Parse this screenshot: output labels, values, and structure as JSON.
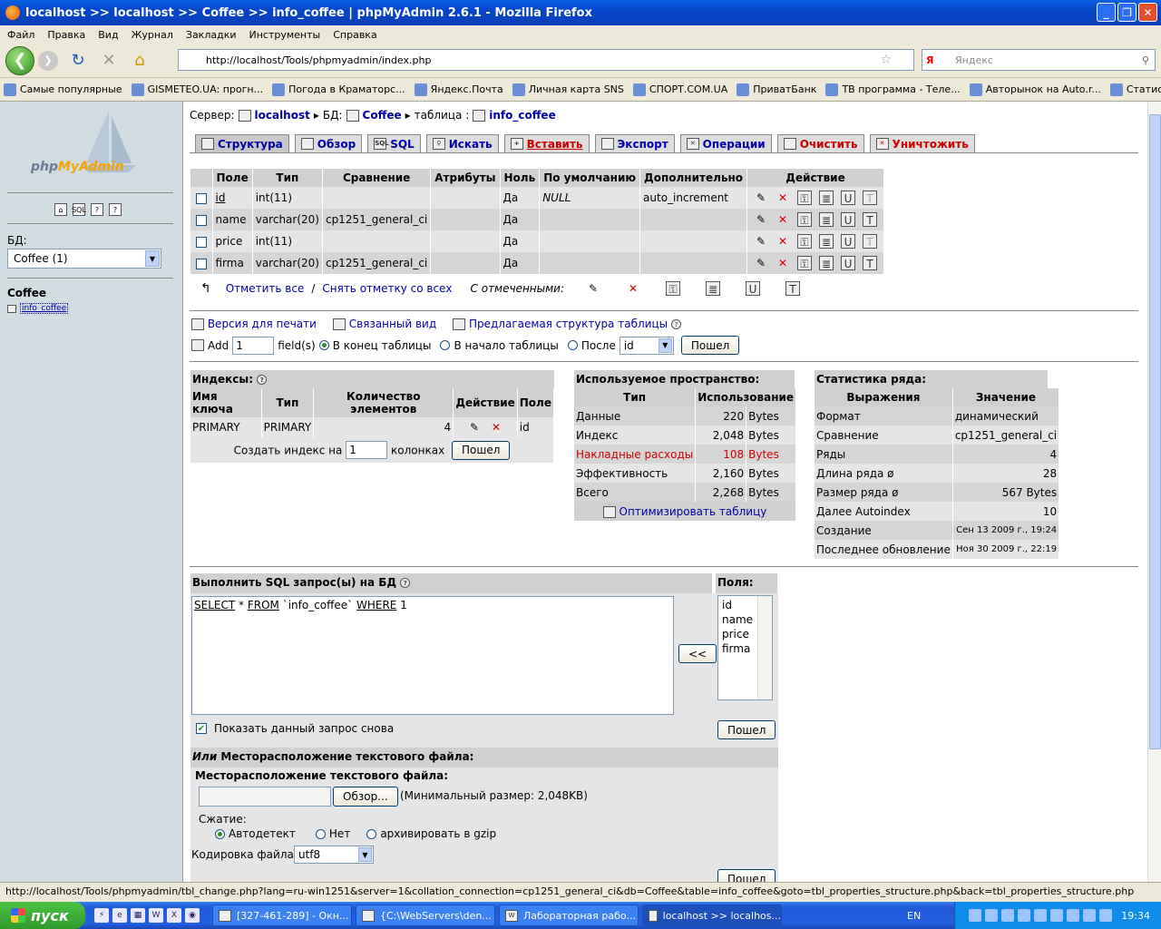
{
  "window": {
    "title": "localhost >> localhost >> Coffee  >> info_coffee | phpMyAdmin 2.6.1 - Mozilla Firefox"
  },
  "menu": [
    "Файл",
    "Правка",
    "Вид",
    "Журнал",
    "Закладки",
    "Инструменты",
    "Справка"
  ],
  "nav": {
    "url": "http://localhost/Tools/phpmyadmin/index.php",
    "search_placeholder": "Яндекс"
  },
  "bookmarks": [
    "Самые популярные",
    "GISMETEO.UA: прогн...",
    "Погода в Краматорс...",
    "Яндекс.Почта",
    "Личная карта SNS",
    "СПОРТ.COM.UA",
    "ПриватБанк",
    "ТВ программа - Теле...",
    "Авторынок на Auto.r...",
    "Статистическая пом..."
  ],
  "left": {
    "logo_a": "php",
    "logo_b": "MyAdmin",
    "db_label": "БД:",
    "db_selected": "Coffee (1)",
    "db_name": "Coffee",
    "table_name": "info_coffee"
  },
  "breadcrumb": {
    "server_label": "Сервер:",
    "server": "localhost",
    "db_label": "БД:",
    "db": "Coffee",
    "table_label": "таблица :",
    "table": "info_coffee"
  },
  "tabs": [
    {
      "label": "Структура",
      "icon": "structure-icon"
    },
    {
      "label": "Обзор",
      "icon": "browse-icon"
    },
    {
      "label": "SQL",
      "icon": "sql-icon"
    },
    {
      "label": "Искать",
      "icon": "search-icon"
    },
    {
      "label": "Вставить",
      "icon": "insert-icon"
    },
    {
      "label": "Экспорт",
      "icon": "export-icon"
    },
    {
      "label": "Операции",
      "icon": "operations-icon"
    },
    {
      "label": "Очистить",
      "icon": "empty-icon"
    },
    {
      "label": "Уничтожить",
      "icon": "drop-icon"
    }
  ],
  "fields": {
    "headers": [
      "Поле",
      "Тип",
      "Сравнение",
      "Атрибуты",
      "Ноль",
      "По умолчанию",
      "Дополнительно",
      "Действие"
    ],
    "rows": [
      {
        "name": "id",
        "type": "int(11)",
        "collation": "",
        "attributes": "",
        "null": "Да",
        "default": "NULL",
        "extra": "auto_increment"
      },
      {
        "name": "name",
        "type": "varchar(20)",
        "collation": "cp1251_general_ci",
        "attributes": "",
        "null": "Да",
        "default": "",
        "extra": ""
      },
      {
        "name": "price",
        "type": "int(11)",
        "collation": "",
        "attributes": "",
        "null": "Да",
        "default": "",
        "extra": ""
      },
      {
        "name": "firma",
        "type": "varchar(20)",
        "collation": "cp1251_general_ci",
        "attributes": "",
        "null": "Да",
        "default": "",
        "extra": ""
      }
    ],
    "check_all": "Отметить все",
    "uncheck_all": "Снять отметку со всех",
    "with_selected": "С отмеченными:"
  },
  "links": {
    "print": "Версия для печати",
    "relation": "Связанный вид",
    "propose": "Предлагаемая структура таблицы"
  },
  "add": {
    "label": "Add",
    "count": "1",
    "fields_label": "field(s)",
    "end": "В конец таблицы",
    "begin": "В начало таблицы",
    "after": "После",
    "after_field": "id",
    "go": "Пошел"
  },
  "indexes": {
    "title": "Индексы:",
    "headers": [
      "Имя ключа",
      "Тип",
      "Количество элементов",
      "Действие",
      "Поле"
    ],
    "row": {
      "key": "PRIMARY",
      "type": "PRIMARY",
      "count": "4",
      "field": "id"
    },
    "create_label": "Создать индекс на",
    "create_count": "1",
    "columns_label": "колонках",
    "go": "Пошел"
  },
  "space": {
    "title": "Используемое пространство:",
    "headers": [
      "Тип",
      "Использование"
    ],
    "rows": [
      {
        "type": "Данные",
        "value": "220",
        "unit": "Bytes"
      },
      {
        "type": "Индекс",
        "value": "2,048",
        "unit": "Bytes"
      },
      {
        "type": "Накладные расходы",
        "value": "108",
        "unit": "Bytes"
      },
      {
        "type": "Эффективность",
        "value": "2,160",
        "unit": "Bytes"
      },
      {
        "type": "Всего",
        "value": "2,268",
        "unit": "Bytes"
      }
    ],
    "optimize": "Оптимизировать таблицу"
  },
  "stats": {
    "title": "Статистика ряда:",
    "headers": [
      "Выражения",
      "Значение"
    ],
    "rows": [
      {
        "k": "Формат",
        "v": "динамический"
      },
      {
        "k": "Сравнение",
        "v": "cp1251_general_ci"
      },
      {
        "k": "Ряды",
        "v": "4"
      },
      {
        "k": "Длина ряда ø",
        "v": "28"
      },
      {
        "k": "Размер ряда  ø",
        "v": "567 Bytes"
      },
      {
        "k": "Далее Autoindex",
        "v": "10"
      },
      {
        "k": "Создание",
        "v": "Сен 13 2009 г., 19:24"
      },
      {
        "k": "Последнее обновление",
        "v": "Ноя 30 2009 г., 22:19"
      }
    ]
  },
  "sql": {
    "title": "Выполнить SQL запрос(ы) на БД",
    "query_select": "SELECT",
    "query_star": " * ",
    "query_from": "FROM",
    "query_table": " `info_coffee` ",
    "query_where": "WHERE",
    "query_rest": " 1",
    "fields_label": "Поля:",
    "fields": [
      "id",
      "name",
      "price",
      "firma"
    ],
    "insert_btn": "<<",
    "show_again": "Показать данный запрос снова",
    "go": "Пошел"
  },
  "file": {
    "or": "Или",
    "title_rest": " Месторасположение текстового файла:",
    "subtitle": "Месторасположение текстового файла:",
    "browse": "Обзор...",
    "min_size": "(Минимальный размер: 2,048KB)",
    "compression": "Сжатие:",
    "auto": "Автодетект",
    "none": "Нет",
    "gzip": "архивировать в gzip",
    "charset_label": "Кодировка файла:",
    "charset": "utf8",
    "go": "Пошел"
  },
  "status": "http://localhost/Tools/phpmyadmin/tbl_change.php?lang=ru-win1251&server=1&collation_connection=cp1251_general_ci&db=Coffee&table=info_coffee&goto=tbl_properties_structure.php&back=tbl_properties_structure.php",
  "taskbar": {
    "start": "пуск",
    "tasks": [
      "[327-461-289] - Окн...",
      "{C:\\WebServers\\den...",
      "Лабораторная рабо...",
      "localhost >> localhos..."
    ],
    "lang": "EN",
    "time": "19:34"
  }
}
